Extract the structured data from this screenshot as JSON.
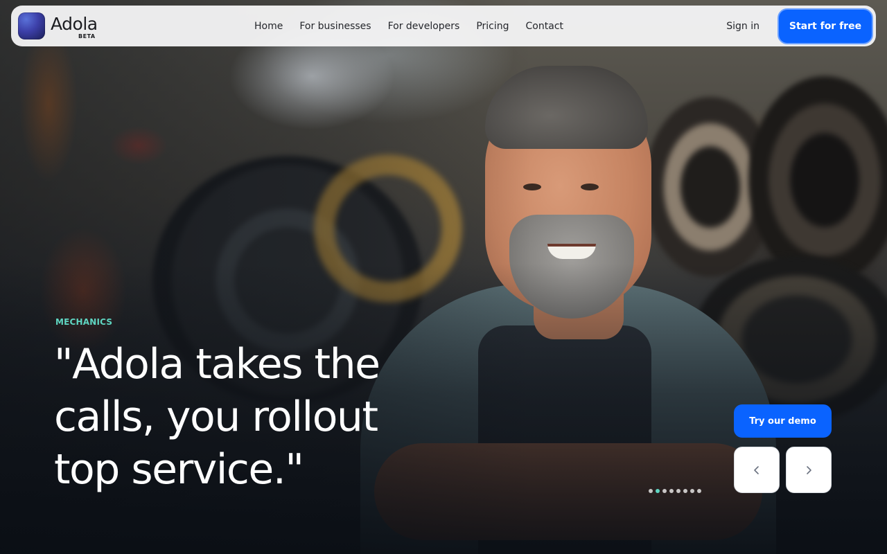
{
  "brand": {
    "name": "Adola",
    "badge": "BETA",
    "logo_icon": "gradient-square-logo"
  },
  "nav": {
    "links": [
      "Home",
      "For businesses",
      "For developers",
      "Pricing",
      "Contact"
    ],
    "sign_in": "Sign in",
    "cta": "Start for free"
  },
  "hero": {
    "eyebrow": "MECHANICS",
    "headline": "\"Adola takes the calls, you rollout top service.\"",
    "image_subject": "smiling mechanic with arms crossed in tire shop"
  },
  "controls": {
    "demo_label": "Try our demo",
    "prev_icon": "chevron-left-icon",
    "next_icon": "chevron-right-icon",
    "slide_count": 8,
    "active_slide": 2
  },
  "colors": {
    "primary": "#0a63ff",
    "accent": "#5fd6c2",
    "navbar_bg": "#f6f7f8",
    "text_dark": "#24262b"
  }
}
